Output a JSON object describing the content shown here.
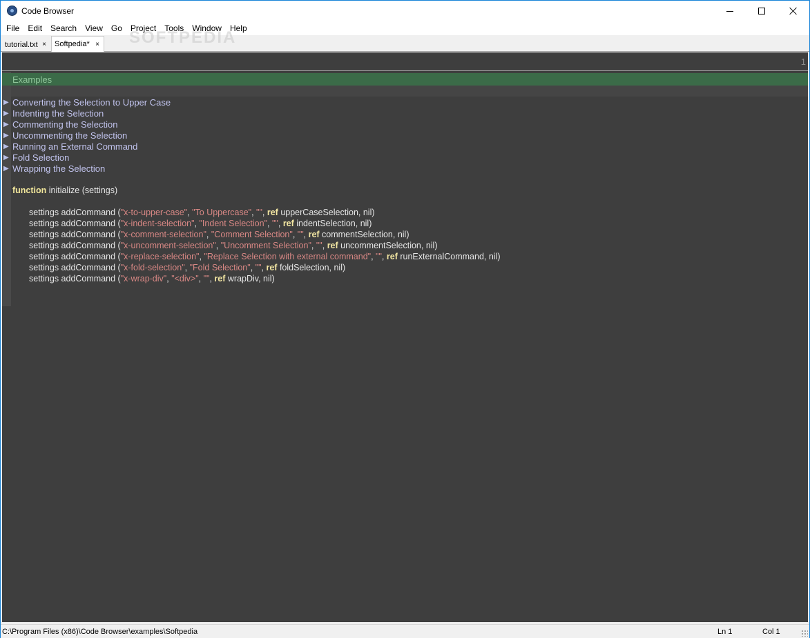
{
  "window": {
    "title": "Code Browser"
  },
  "menu": [
    "File",
    "Edit",
    "Search",
    "View",
    "Go",
    "Project",
    "Tools",
    "Window",
    "Help"
  ],
  "tabs": [
    {
      "label": "tutorial.txt",
      "close": "×"
    },
    {
      "label": "Softpedia*",
      "close": "×"
    }
  ],
  "watermark": "SOFTPEDIA",
  "editor": {
    "ruler_number": "1",
    "section_title": "Examples",
    "folds": [
      "Converting the Selection to Upper Case",
      "Indenting the Selection",
      "Commenting the Selection",
      "Uncommenting the Selection",
      "Running an External Command",
      "Fold Selection",
      "Wrapping the Selection"
    ],
    "fold_arrow": "▶",
    "function_keyword": "function",
    "function_signature": " initialize (settings)",
    "command_prefix": "settings addCommand (",
    "ref_keyword": "ref",
    "commands": [
      {
        "id": "\"x-to-upper-case\"",
        "label": "\"To Uppercase\"",
        "shortcut": "\"\"",
        "target": " upperCaseSelection, nil)"
      },
      {
        "id": "\"x-indent-selection\"",
        "label": "\"Indent Selection\"",
        "shortcut": "\"\"",
        "target": " indentSelection, nil)"
      },
      {
        "id": "\"x-comment-selection\"",
        "label": "\"Comment Selection\"",
        "shortcut": "\"\"",
        "target": " commentSelection, nil)"
      },
      {
        "id": "\"x-uncomment-selection\"",
        "label": "\"Uncomment Selection\"",
        "shortcut": "\"\"",
        "target": " uncommentSelection, nil)"
      },
      {
        "id": "\"x-replace-selection\"",
        "label": "\"Replace Selection with external command\"",
        "shortcut": "\"\"",
        "target": " runExternalCommand, nil)"
      },
      {
        "id": "\"x-fold-selection\"",
        "label": "\"Fold Selection\"",
        "shortcut": "\"\"",
        "target": " foldSelection, nil)"
      },
      {
        "id": "\"x-wrap-div\"",
        "label": "\"<div>\"",
        "shortcut": "\"\"",
        "target": " wrapDiv, nil)"
      }
    ]
  },
  "status": {
    "path": "C:\\Program Files (x86)\\Code Browser\\examples\\Softpedia",
    "line": "Ln 1",
    "column": "Col 1"
  },
  "colors": {
    "editor_bg": "#3e3e3e",
    "section_bar": "#3b6b48",
    "keyword": "#f0e59a",
    "string": "#d98885",
    "fold_text": "#c1c3ed"
  }
}
